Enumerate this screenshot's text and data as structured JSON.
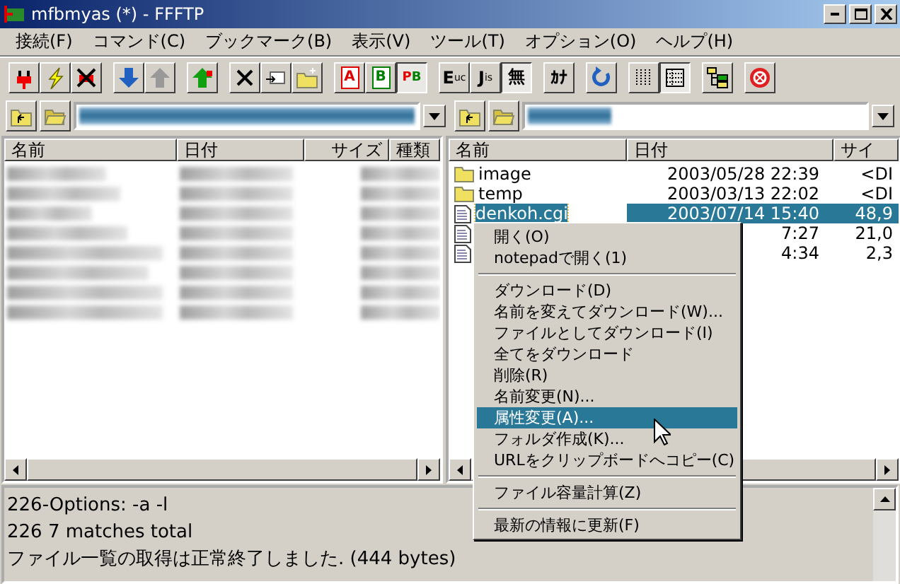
{
  "window": {
    "title": "mfbmyas (*) - FFFTP"
  },
  "menu_bar": [
    "接続(F)",
    "コマンド(C)",
    "ブックマーク(B)",
    "表示(V)",
    "ツール(T)",
    "オプション(O)",
    "ヘルプ(H)"
  ],
  "toolbar": [
    [
      {
        "kind": "connect",
        "pressed": false
      },
      {
        "kind": "quick-connect",
        "pressed": false
      },
      {
        "kind": "disconnect",
        "pressed": false
      }
    ],
    [
      {
        "kind": "download",
        "pressed": false
      },
      {
        "kind": "upload",
        "pressed": false
      }
    ],
    [
      {
        "kind": "mirror-upload",
        "pressed": false
      }
    ],
    [
      {
        "kind": "delete",
        "pressed": false
      },
      {
        "kind": "rename",
        "pressed": false
      },
      {
        "kind": "new-folder",
        "pressed": false
      }
    ],
    [
      {
        "kind": "letter",
        "label": "A",
        "color": "#e00000",
        "pressed": false
      },
      {
        "kind": "letter",
        "label": "B",
        "color": "#008000",
        "pressed": false
      },
      {
        "kind": "letter-pair",
        "label": "P",
        "label2": "B",
        "pressed": true
      }
    ],
    [
      {
        "kind": "text",
        "label": "E",
        "sub": "uc",
        "pressed": false
      },
      {
        "kind": "text",
        "label": "J",
        "sub": "is",
        "pressed": false
      },
      {
        "kind": "text",
        "label": "無",
        "pressed": true
      }
    ],
    [
      {
        "kind": "text",
        "label": "ｶﾅ",
        "pressed": false
      }
    ],
    [
      {
        "kind": "refresh",
        "pressed": false
      }
    ],
    [
      {
        "kind": "list-view",
        "pressed": false
      },
      {
        "kind": "detail-view",
        "pressed": true
      }
    ],
    [
      {
        "kind": "tree",
        "pressed": false
      }
    ],
    [
      {
        "kind": "stop",
        "pressed": false
      }
    ]
  ],
  "left_pane": {
    "path": {
      "redacted": true
    },
    "columns": [
      "名前",
      "日付",
      "サイズ",
      "種類"
    ],
    "rows": [
      {
        "redacted": true
      },
      {
        "redacted": true
      },
      {
        "redacted": true
      },
      {
        "redacted": true
      },
      {
        "redacted": true
      },
      {
        "redacted": true
      },
      {
        "redacted": true
      },
      {
        "redacted": true
      }
    ]
  },
  "right_pane": {
    "path": {
      "redacted": true
    },
    "columns": [
      "名前",
      "日付",
      "サイ"
    ],
    "rows": [
      {
        "kind": "folder",
        "name": "image",
        "date": "2003/05/28 22:39",
        "size": "<DI",
        "selected": false
      },
      {
        "kind": "folder",
        "name": "temp",
        "date": "2003/03/13 22:02",
        "size": "<DI",
        "selected": false
      },
      {
        "kind": "file",
        "name": "denkoh.cgi",
        "date": "2003/07/14 15:40",
        "size": "48,9",
        "selected": true
      },
      {
        "kind": "file",
        "date": "7:27",
        "size": "21,0",
        "selected": false
      },
      {
        "kind": "file",
        "date": "4:34",
        "size": "2,3",
        "selected": false
      }
    ]
  },
  "context_menu": [
    {
      "kind": "item",
      "label": "開く(O)",
      "selected": false
    },
    {
      "kind": "item",
      "label": "notepadで開く(1)",
      "selected": false
    },
    {
      "kind": "separator"
    },
    {
      "kind": "item",
      "label": "ダウンロード(D)",
      "selected": false
    },
    {
      "kind": "item",
      "label": "名前を変えてダウンロード(W)...",
      "selected": false
    },
    {
      "kind": "item",
      "label": "ファイルとしてダウンロード(I)",
      "selected": false
    },
    {
      "kind": "item",
      "label": "全てをダウンロード",
      "selected": false
    },
    {
      "kind": "item",
      "label": "削除(R)",
      "selected": false
    },
    {
      "kind": "item",
      "label": "名前変更(N)...",
      "selected": false
    },
    {
      "kind": "item",
      "label": "属性変更(A)...",
      "selected": true
    },
    {
      "kind": "item",
      "label": "フォルダ作成(K)...",
      "selected": false
    },
    {
      "kind": "item",
      "label": "URLをクリップボードへコピー(C)",
      "selected": false
    },
    {
      "kind": "separator"
    },
    {
      "kind": "item",
      "label": "ファイル容量計算(Z)",
      "selected": false
    },
    {
      "kind": "separator"
    },
    {
      "kind": "item",
      "label": "最新の情報に更新(F)",
      "selected": false
    }
  ],
  "log": [
    "226-Options: -a -l",
    "226 7 matches total",
    "ファイル一覧の取得は正常終了しました. (444 bytes)"
  ]
}
